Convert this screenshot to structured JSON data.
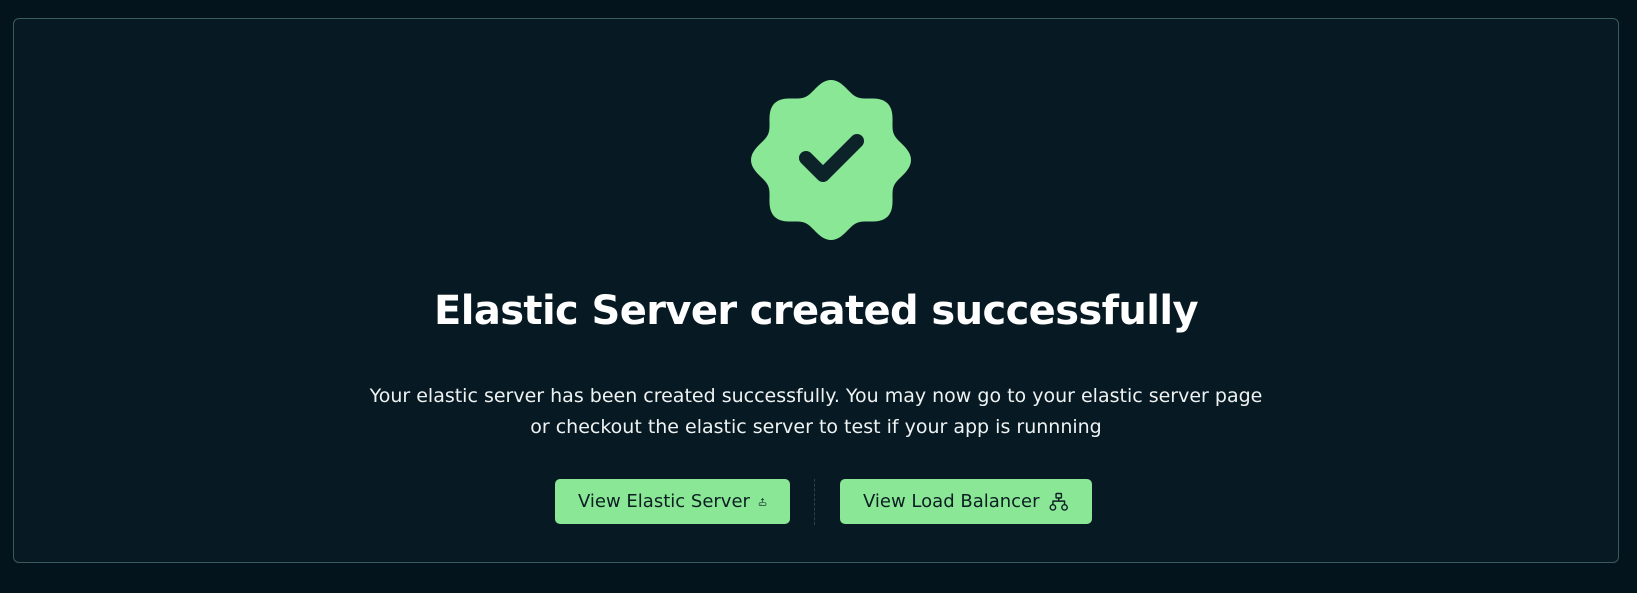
{
  "success": {
    "title": "Elastic Server created successfully",
    "description_line1": "Your elastic server has been created successfully. You may now go to your elastic server page",
    "description_line2": "or checkout the elastic server to test if your app is runnning",
    "badge_icon": "verified-check-badge-icon",
    "badge_color": "#8ae796",
    "check_color": "#0d232a"
  },
  "actions": {
    "view_server_label": "View Elastic Server",
    "view_server_icon": "server-upload-icon",
    "view_lb_label": "View Load Balancer",
    "view_lb_icon": "network-hierarchy-icon",
    "button_color": "#8ae796"
  },
  "theme": {
    "background": "#03141d",
    "card_background": "#071a23",
    "card_border": "#3b5a5b"
  }
}
